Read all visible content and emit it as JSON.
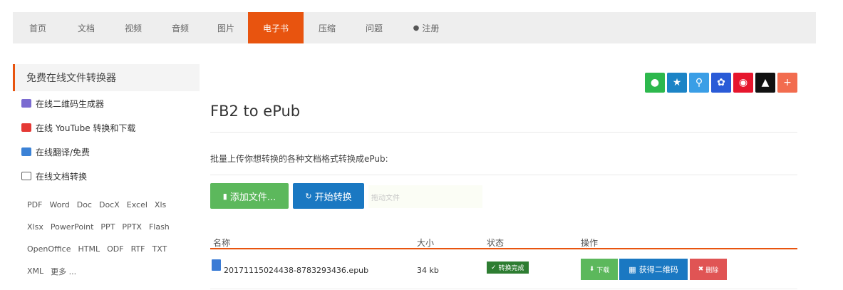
{
  "nav": {
    "items": [
      {
        "label": "首页",
        "active": false
      },
      {
        "label": "文档",
        "active": false
      },
      {
        "label": "视频",
        "active": false
      },
      {
        "label": "音频",
        "active": false
      },
      {
        "label": "图片",
        "active": false
      },
      {
        "label": "电子书",
        "active": true
      },
      {
        "label": "压缩",
        "active": false
      },
      {
        "label": "问题",
        "active": false
      },
      {
        "label": "注册",
        "active": false,
        "icon": "user-icon"
      }
    ],
    "accent": "#e8540f"
  },
  "sidebar": {
    "heading": "免费在线文件转换器",
    "links": [
      {
        "label": "在线二维码生成器",
        "icon": "qrcode-icon",
        "color": "#7b6bd1"
      },
      {
        "label": "在线 YouTube 转换和下载",
        "icon": "youtube-icon",
        "color": "#e53935"
      },
      {
        "label": "在线翻译/免费",
        "icon": "translate-icon",
        "color": "#3b82d6"
      },
      {
        "label": "在线文档转换",
        "icon": "document-icon",
        "color": "#666666"
      }
    ],
    "formats": [
      "PDF",
      "Word",
      "Doc",
      "DocX",
      "Excel",
      "Xls",
      "Xlsx",
      "PowerPoint",
      "PPT",
      "PPTX",
      "Flash",
      "OpenOffice",
      "HTML",
      "ODF",
      "RTF",
      "TXT",
      "XML",
      "更多 ..."
    ]
  },
  "share": [
    {
      "icon": "wechat-icon",
      "color": "#2db84d"
    },
    {
      "icon": "star-icon",
      "color": "#1c84c6"
    },
    {
      "icon": "qzone-icon",
      "color": "#3a9ee6"
    },
    {
      "icon": "baidu-icon",
      "color": "#2a5bd7"
    },
    {
      "icon": "weibo-icon",
      "color": "#e6162d"
    },
    {
      "icon": "qq-icon",
      "color": "#111111"
    },
    {
      "icon": "plus-icon",
      "color": "#f26c4f"
    }
  ],
  "main": {
    "title": "FB2 to ePub",
    "intro": "批量上传你想转换的各种文档格式转换成ePub:",
    "add_button": "添加文件...",
    "start_button": "开始转换",
    "ghost_text": "拖动文件"
  },
  "table": {
    "headers": [
      "名称",
      "大小",
      "状态",
      "操作"
    ],
    "rows": [
      {
        "name": "20171115024438-8783293436.epub",
        "size": "34 kb",
        "status": "转换完成",
        "download": "下载",
        "qr": "获得二维码",
        "delete": "删除"
      }
    ]
  }
}
